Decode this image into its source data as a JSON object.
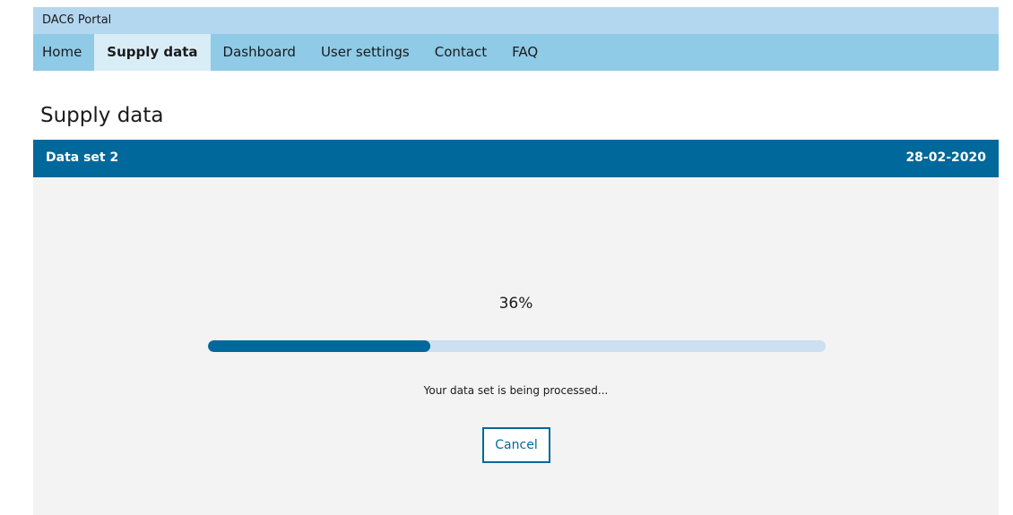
{
  "portal": {
    "name": "DAC6 Portal"
  },
  "nav": {
    "items": [
      {
        "label": "Home",
        "active": false
      },
      {
        "label": "Supply data",
        "active": true
      },
      {
        "label": "Dashboard",
        "active": false
      },
      {
        "label": "User settings",
        "active": false
      },
      {
        "label": "Contact",
        "active": false
      },
      {
        "label": "FAQ",
        "active": false
      }
    ]
  },
  "page": {
    "title": "Supply data"
  },
  "dataset": {
    "name": "Data set 2",
    "date": "28-02-2020"
  },
  "progress": {
    "percent_label": "36%",
    "value": 0.36,
    "status": "Your data set is being processed...",
    "cancel_label": "Cancel"
  },
  "colors": {
    "header_bg": "#b3d7ee",
    "nav_bg": "#8fcae7",
    "nav_active_bg": "#d9edf7",
    "accent": "#01689b",
    "track": "#cce0f1",
    "panel_bg": "#f3f3f3"
  }
}
